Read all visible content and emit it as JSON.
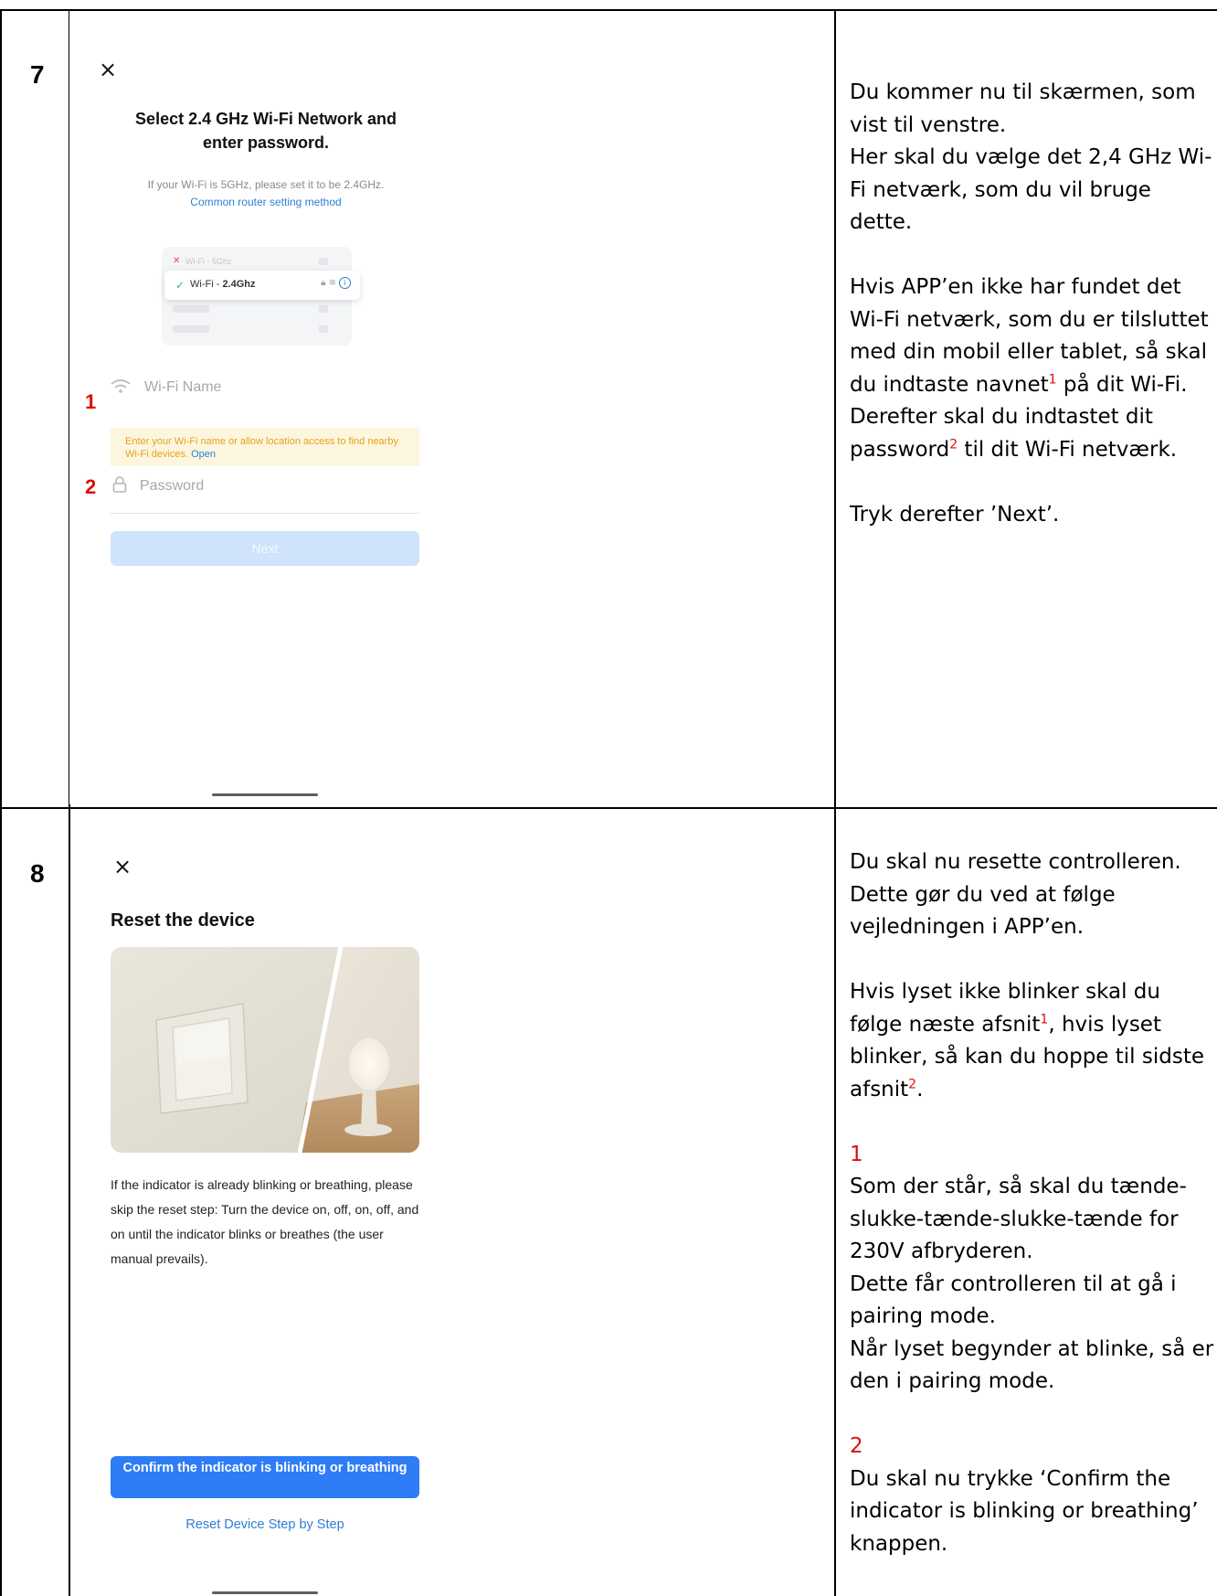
{
  "steps": [
    {
      "number": "7",
      "screen": {
        "close_glyph": "×",
        "title_line1": "Select 2.4 GHz Wi-Fi Network and",
        "title_line2": "enter password.",
        "subtitle": "If your Wi-Fi is 5GHz, please set it to be 2.4GHz.",
        "router_link": "Common router setting method",
        "illustration": {
          "wifi_5g_label": "Wi-Fi - 5Ghz",
          "wifi_24_prefix": "Wi-Fi - ",
          "wifi_24_band": "2.4Ghz"
        },
        "wifi_name_placeholder": "Wi-Fi Name",
        "location_notice": "Enter your Wi-Fi name or allow location access to find nearby Wi-Fi devices.",
        "location_open_link": "Open",
        "password_placeholder": "Password",
        "next_button": "Next",
        "marker_1": "1",
        "marker_2": "2"
      },
      "description": {
        "p1": "Du kommer nu til skærmen, som vist til venstre.",
        "p2": "Her skal du vælge det 2,4 GHz Wi-Fi netværk, som du vil bruge dette.",
        "p3_before": "Hvis APP’en ikke har fundet det Wi-Fi netværk, som du er tilsluttet med din mobil eller tablet, så skal du indtaste navnet",
        "p3_sup": "1",
        "p3_after": " på dit Wi-Fi.",
        "p4_before": "Derefter skal du indtastet dit password",
        "p4_sup": "2",
        "p4_after": " til dit Wi-Fi netværk.",
        "p5": "Tryk derefter ’Next’."
      }
    },
    {
      "number": "8",
      "screen": {
        "close_glyph": "×",
        "title": "Reset the device",
        "instructions": "If the indicator is already blinking or breathing, please skip the reset step: Turn the device on, off, on, off, and on until the indicator blinks or breathes (the user manual prevails).",
        "confirm_button": "Confirm the indicator is blinking or breathing",
        "reset_link": "Reset Device Step by Step"
      },
      "description": {
        "p1": "Du skal nu resette controlleren. Dette gør du ved at følge vejledningen i APP’en.",
        "p2_before": "Hvis lyset ikke blinker skal du følge næste afsnit",
        "p2_sup1": "1",
        "p2_mid": ", hvis lyset blinker, så kan du hoppe til sidste afsnit",
        "p2_sup2": "2",
        "p2_after": ".",
        "sec1_num": "1",
        "sec1_text1": "Som der står, så skal du tænde-slukke-tænde-slukke-tænde for 230V afbryderen.",
        "sec1_text2": "Dette får controlleren til at gå i pairing mode.",
        "sec1_text3": "Når lyset begynder at blinke, så er den i pairing mode.",
        "sec2_num": "2",
        "sec2_text": "Du skal nu trykke ‘Confirm the indicator is blinking or breathing’ knappen."
      }
    }
  ],
  "colors": {
    "accent_red": "#e10b0b",
    "link_blue": "#2d7fd4",
    "button_blue": "#2e7cf6",
    "disabled_button": "#cfe4fb",
    "notice_bg": "#fdf6df",
    "notice_text": "#e4a21a"
  }
}
